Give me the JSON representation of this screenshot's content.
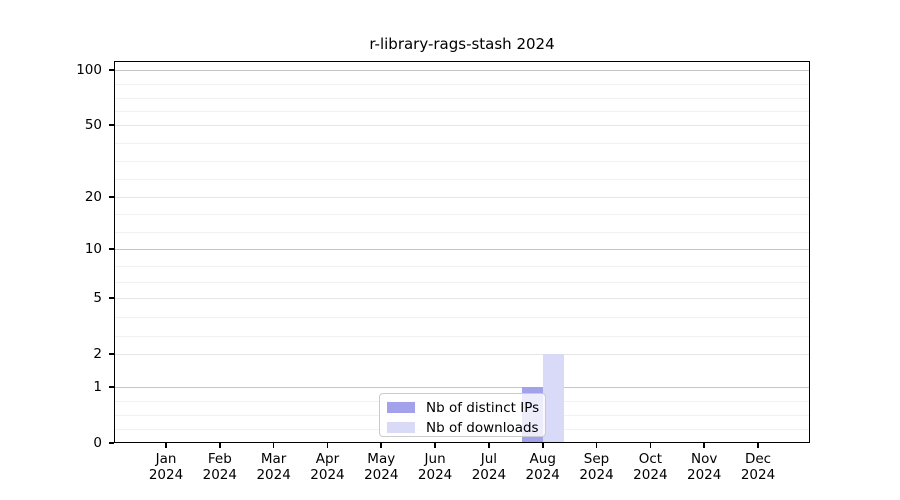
{
  "figure": {
    "background": "#ffffff"
  },
  "chart_data": {
    "type": "bar",
    "title": "r-library-rags-stash 2024",
    "year": "2024",
    "months": [
      "Jan",
      "Feb",
      "Mar",
      "Apr",
      "May",
      "Jun",
      "Jul",
      "Aug",
      "Sep",
      "Oct",
      "Nov",
      "Dec"
    ],
    "categories": [
      "Jan 2024",
      "Feb 2024",
      "Mar 2024",
      "Apr 2024",
      "May 2024",
      "Jun 2024",
      "Jul 2024",
      "Aug 2024",
      "Sep 2024",
      "Oct 2024",
      "Nov 2024",
      "Dec 2024"
    ],
    "series": [
      {
        "name": "Nb of distinct IPs",
        "color": "#a2a2ec",
        "values": [
          0,
          0,
          0,
          0,
          0,
          0,
          0,
          1,
          0,
          0,
          0,
          0
        ]
      },
      {
        "name": "Nb of downloads",
        "color": "#d9d9f8",
        "values": [
          0,
          0,
          0,
          0,
          0,
          0,
          0,
          2,
          0,
          0,
          0,
          0
        ]
      }
    ],
    "yticks": [
      0,
      1,
      2,
      5,
      10,
      20,
      50,
      100
    ],
    "yscale": "log1p",
    "ylim": [
      0,
      112
    ],
    "xlabel": "",
    "ylabel": "",
    "grid": "horizontal",
    "legend": {
      "position": "bottom-center-inside",
      "entries": [
        "Nb of distinct IPs",
        "Nb of downloads"
      ]
    }
  }
}
